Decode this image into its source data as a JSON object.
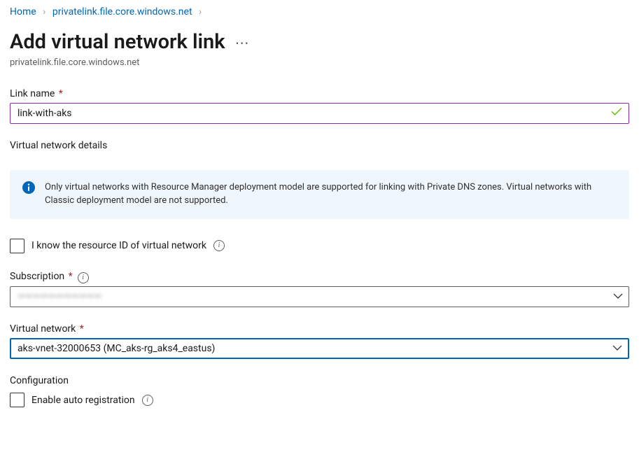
{
  "breadcrumb": {
    "home": "Home",
    "zone": "privatelink.file.core.windows.net"
  },
  "header": {
    "title": "Add virtual network link",
    "subtitle": "privatelink.file.core.windows.net"
  },
  "link_name": {
    "label": "Link name",
    "value": "link-with-aks"
  },
  "section_vnet_details": "Virtual network details",
  "info_banner": {
    "text": "Only virtual networks with Resource Manager deployment model are supported for linking with Private DNS zones. Virtual networks with Classic deployment model are not supported."
  },
  "know_resource_id": {
    "label": "I know the resource ID of virtual network",
    "checked": false
  },
  "subscription": {
    "label": "Subscription",
    "value": "———————————"
  },
  "virtual_network": {
    "label": "Virtual network",
    "value": "aks-vnet-32000653 (MC_aks-rg_aks4_eastus)"
  },
  "section_configuration": "Configuration",
  "auto_registration": {
    "label": "Enable auto registration",
    "checked": false
  },
  "colors": {
    "link": "#0067b8",
    "focus_border": "#0067b8",
    "input_border_purple": "#8a2da5",
    "info_bg": "#eff6fc"
  }
}
